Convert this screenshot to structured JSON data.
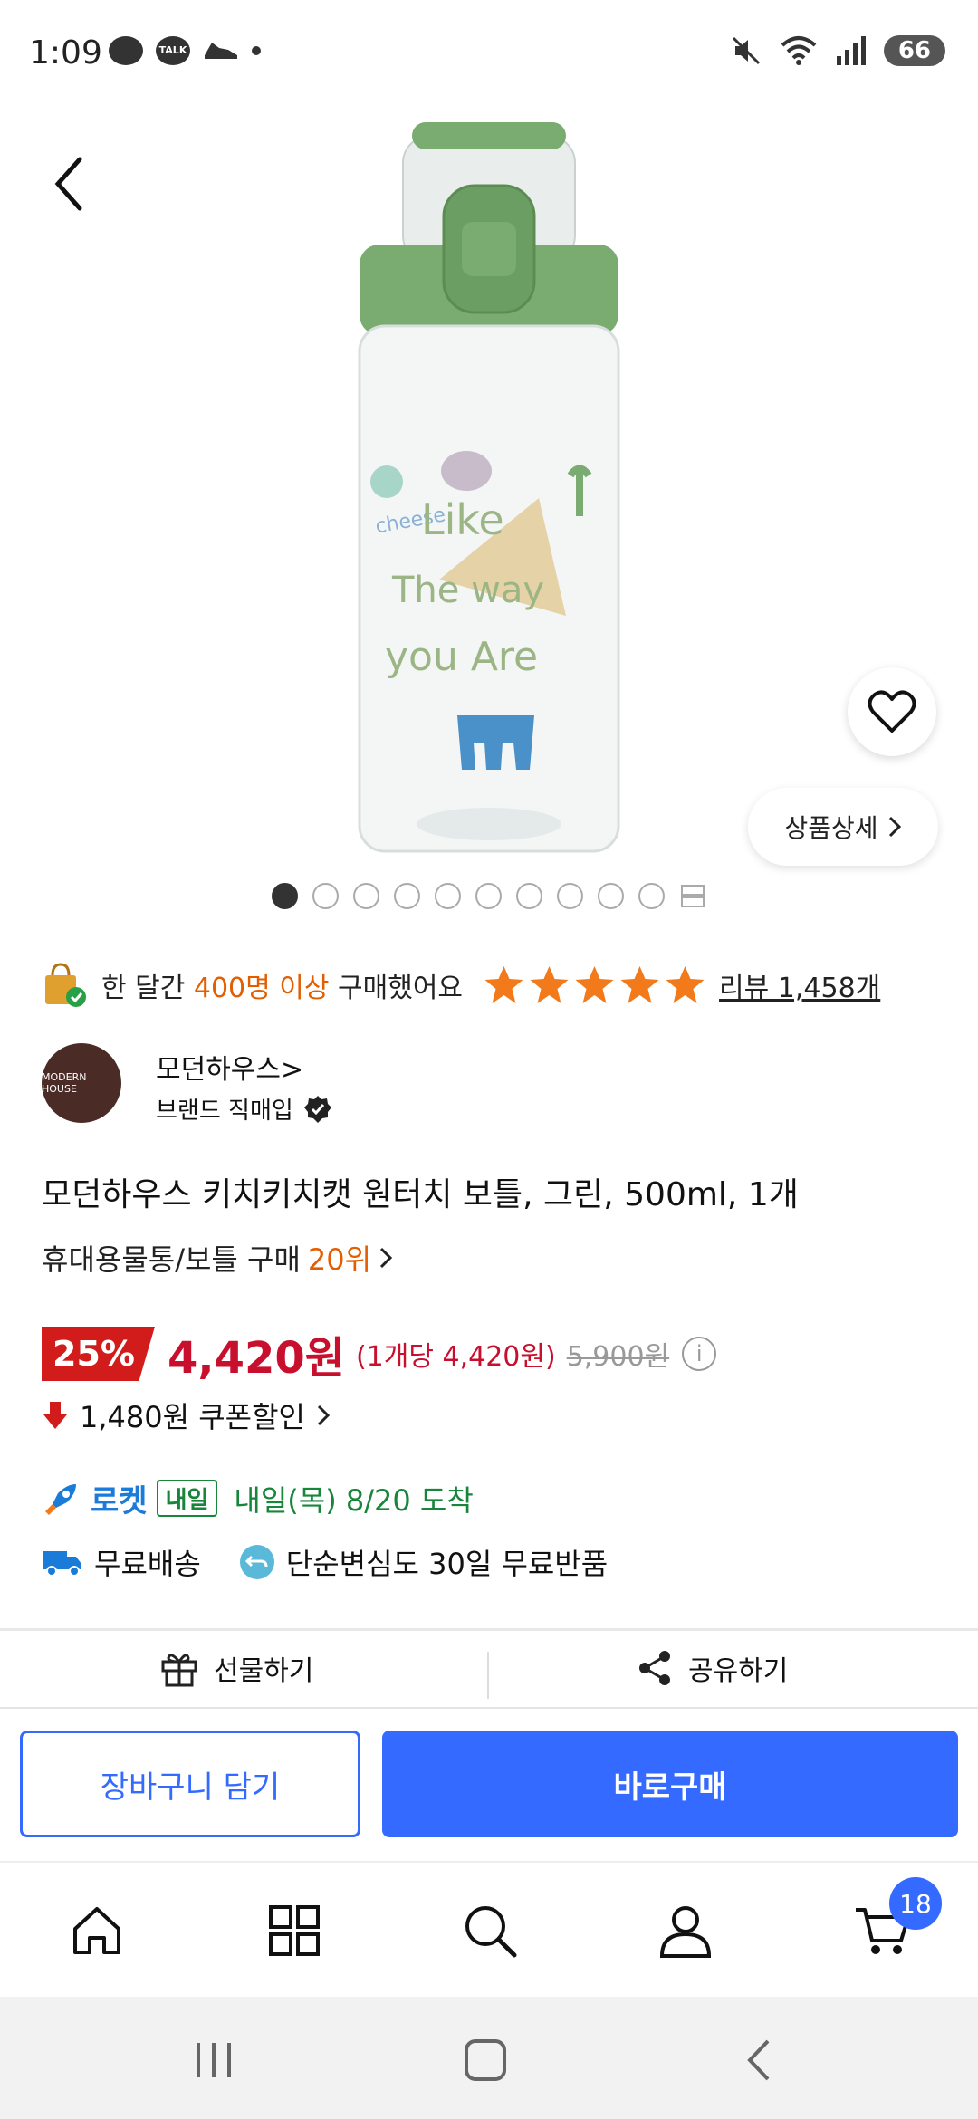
{
  "status_bar": {
    "time": "1:09",
    "talk_badge": "TALK",
    "battery": "66"
  },
  "product_image": {
    "bottle_text_lines": [
      "cheese",
      "Like",
      "The way",
      "you Are"
    ],
    "detail_button_label": "상품상세",
    "page_count": 10,
    "active_page": 1
  },
  "purchase_info": {
    "prefix": "한 달간 ",
    "count": "400명 이상",
    "suffix": " 구매했어요",
    "rating": 5,
    "review_label": "리뷰 1,458개"
  },
  "seller": {
    "logo_text": "MODERN HOUSE",
    "name": "모던하우스>",
    "subtitle": "브랜드 직매입"
  },
  "product": {
    "title": "모던하우스 키치키치캣 원터치 보틀, 그린, 500ml, 1개",
    "rank_prefix": "휴대용물통/보틀 구매",
    "rank": "20위"
  },
  "price": {
    "discount": "25%",
    "sale": "4,420원",
    "unit": "(1개당 4,420원)",
    "original": "5,900원",
    "coupon": "1,480원 쿠폰할인"
  },
  "delivery": {
    "rocket_label": "로켓",
    "tomorrow_tag": "내일",
    "arrival": "내일(목) 8/20 도착",
    "free_shipping": "무료배송",
    "free_return": "단순변심도 30일 무료반품"
  },
  "actions": {
    "gift": "선물하기",
    "share": "공유하기",
    "add_to_cart": "장바구니 담기",
    "buy_now": "바로구매"
  },
  "tabbar": {
    "cart_count": "18"
  },
  "colors": {
    "brand_blue": "#346aff",
    "sale_red": "#c8102e",
    "rank_orange": "#e35e00",
    "delivery_green": "#17853a",
    "star_orange": "#f27a1a",
    "cap_green": "#7aab70"
  }
}
